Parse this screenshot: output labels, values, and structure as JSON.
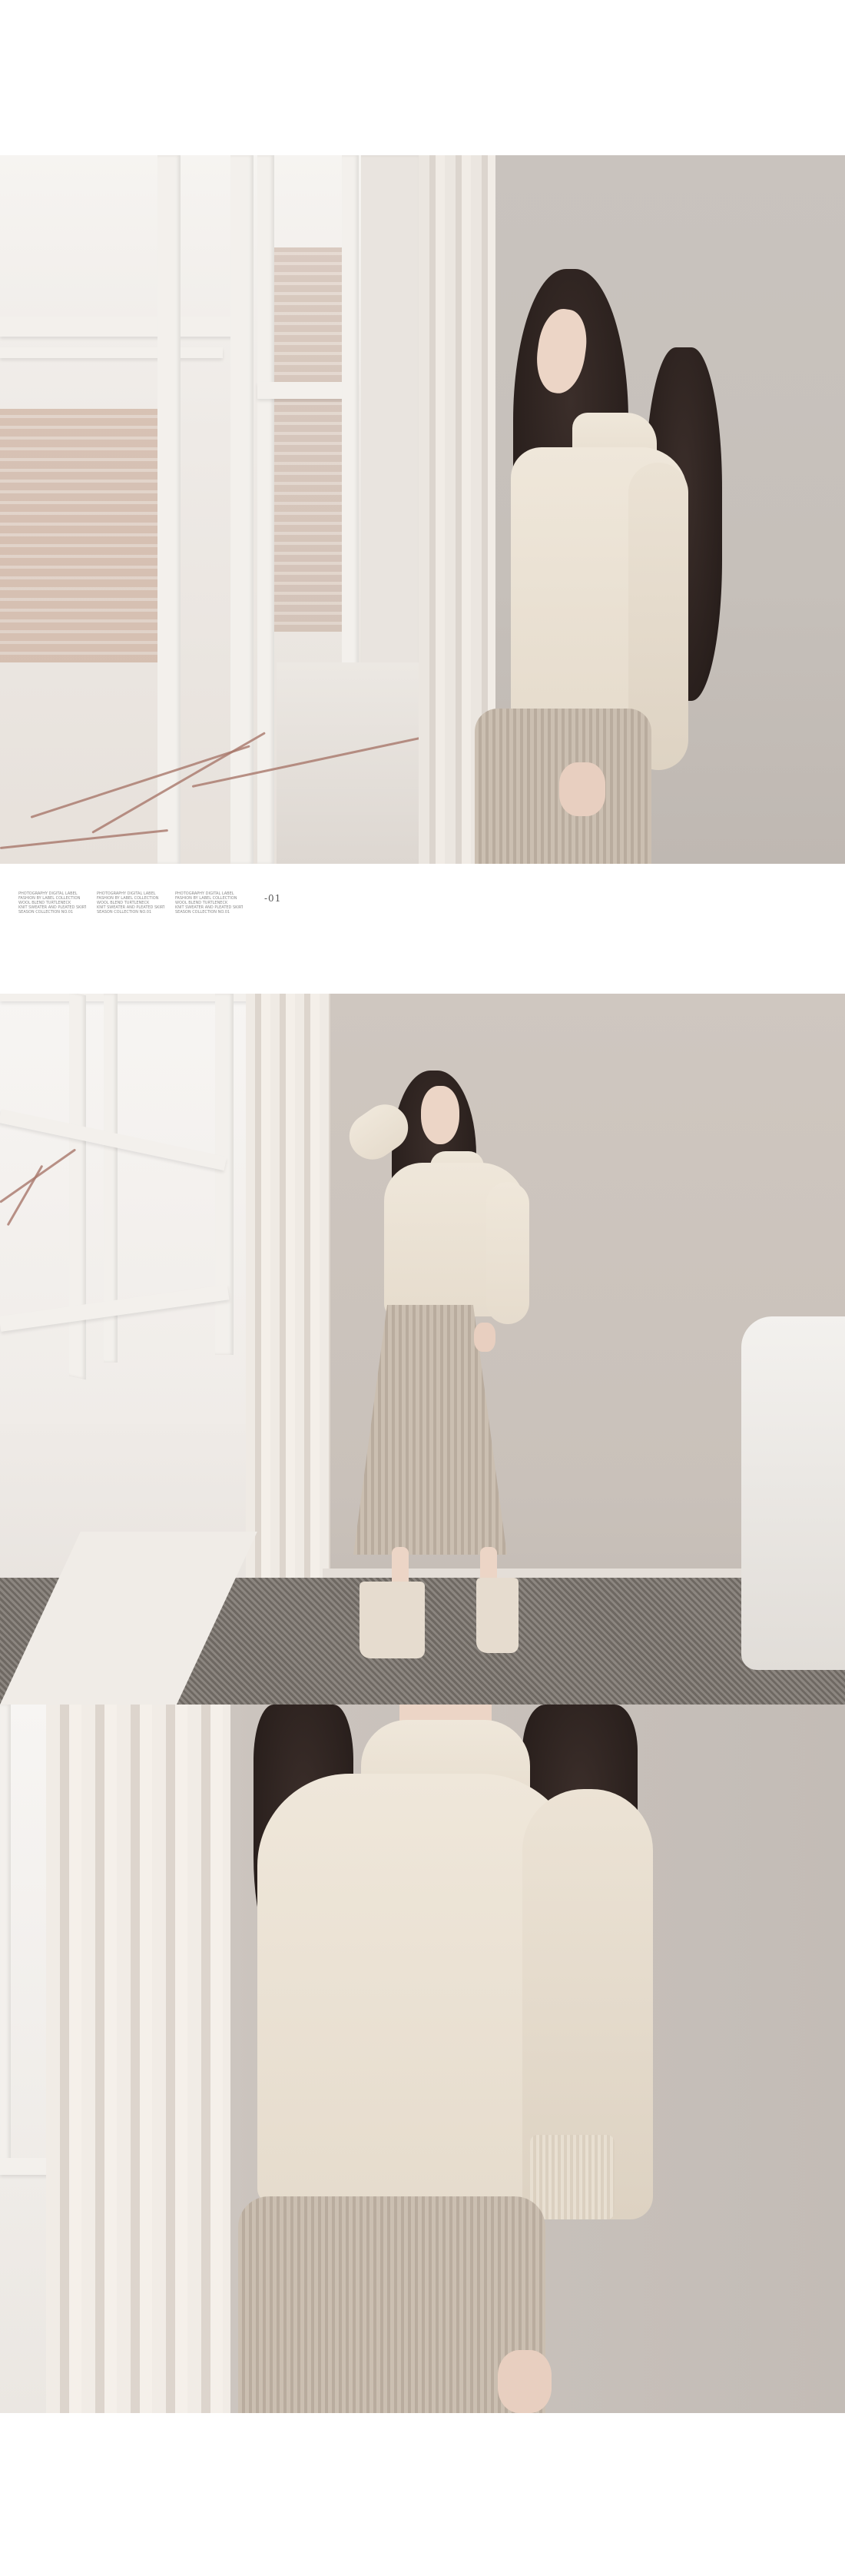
{
  "page": {
    "background_color": "#ffffff"
  },
  "photos": [
    {
      "name": "model-by-window-photo",
      "description_icon": "photo-icon"
    },
    {
      "name": "model-full-body-photo",
      "description_icon": "photo-icon"
    },
    {
      "name": "model-detail-photo",
      "description_icon": "photo-icon"
    }
  ],
  "caption": {
    "columns": [
      {
        "lines": [
          "PHOTOGRAPHY  DIGITAL LABEL",
          "FASHION BY LABEL COLLECTION",
          "WOOL BLEND TURTLENECK",
          "KNIT SWEATER AND PLEATED SKIRT",
          "SEASON COLLECTION NO.01"
        ]
      },
      {
        "lines": [
          "PHOTOGRAPHY  DIGITAL LABEL",
          "FASHION BY LABEL COLLECTION",
          "WOOL BLEND TURTLENECK",
          "KNIT SWEATER AND PLEATED SKIRT",
          "SEASON COLLECTION NO.01"
        ]
      },
      {
        "lines": [
          "PHOTOGRAPHY  DIGITAL LABEL",
          "FASHION BY LABEL COLLECTION",
          "WOOL BLEND TURTLENECK",
          "KNIT SWEATER AND PLEATED SKIRT",
          "SEASON COLLECTION NO.01"
        ]
      }
    ],
    "number": "-01"
  },
  "colors": {
    "sweater": "#efe7da",
    "skirt": "#c3b6a8",
    "hair": "#2a201d",
    "wall": "#c9c3be"
  }
}
